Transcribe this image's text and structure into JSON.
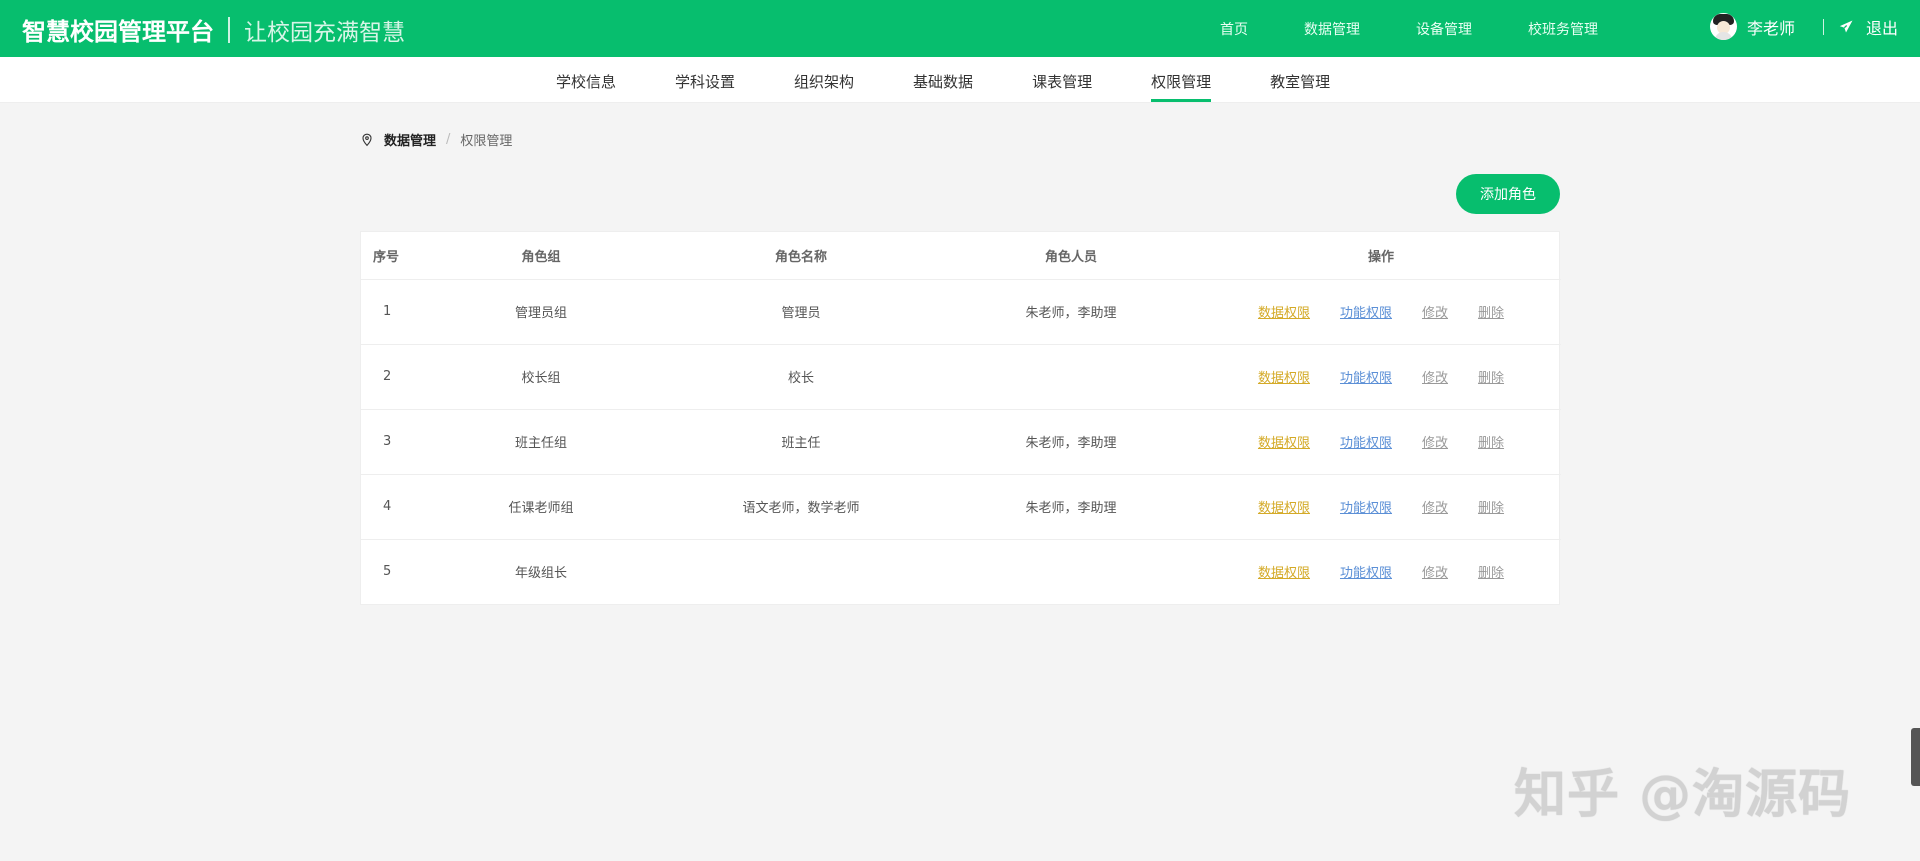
{
  "header": {
    "title": "智慧校园管理平台",
    "slogan": "让校园充满智慧",
    "nav": [
      "首页",
      "数据管理",
      "设备管理",
      "校班务管理"
    ],
    "user": "李老师",
    "logout": "退出"
  },
  "subnav": {
    "items": [
      "学校信息",
      "学科设置",
      "组织架构",
      "基础数据",
      "课表管理",
      "权限管理",
      "教室管理"
    ],
    "active_index": 5
  },
  "breadcrumb": {
    "first": "数据管理",
    "separator": "/",
    "current": "权限管理"
  },
  "toolbar": {
    "add_role": "添加角色"
  },
  "table": {
    "columns": [
      "序号",
      "角色组",
      "角色名称",
      "角色人员",
      "操作"
    ],
    "ops": [
      "数据权限",
      "功能权限",
      "修改",
      "删除"
    ],
    "rows": [
      [
        "1",
        "管理员组",
        "管理员",
        "朱老师，李助理"
      ],
      [
        "2",
        "校长组",
        "校长",
        ""
      ],
      [
        "3",
        "班主任组",
        "班主任",
        "朱老师，李助理"
      ],
      [
        "4",
        "任课老师组",
        "语文老师，数学老师",
        "朱老师，李助理"
      ],
      [
        "5",
        "年级组长",
        "",
        ""
      ]
    ]
  },
  "watermark": "知乎 @淘源码",
  "colors": {
    "brand": "#07be6e",
    "data_op": "#d4aa27",
    "func_op": "#5b8fd6"
  },
  "icons": {
    "location": "map-pin-icon",
    "logout": "send-icon",
    "avatar": "user-avatar-icon"
  }
}
